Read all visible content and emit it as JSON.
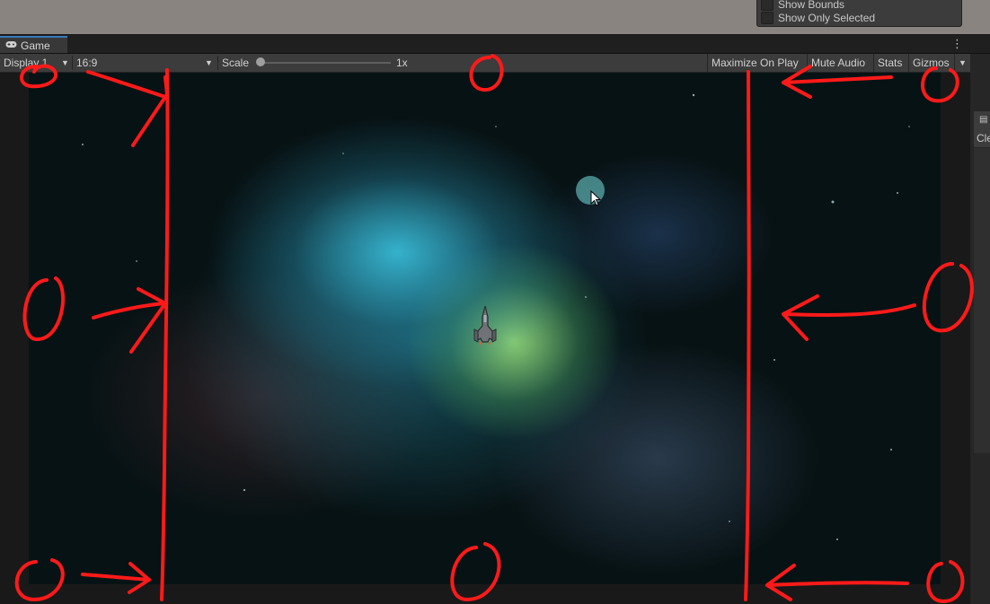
{
  "scene_gizmos": {
    "show_bounds_label": "Show Bounds",
    "show_only_selected_label": "Show Only Selected"
  },
  "tab": {
    "label": "Game",
    "icon": "gamepad-icon"
  },
  "toolbar": {
    "display_label": "Display 1",
    "aspect_label": "16:9",
    "scale_label": "Scale",
    "scale_value": "1x",
    "maximize_label": "Maximize On Play",
    "mute_label": "Mute Audio",
    "stats_label": "Stats",
    "gizmos_label": "Gizmos"
  },
  "right_panel": {
    "label": "Cle"
  },
  "colors": {
    "annotation_red": "#ff1a1a",
    "tab_accent": "#3a79bb",
    "toolbar_bg": "#3c3c3c"
  }
}
